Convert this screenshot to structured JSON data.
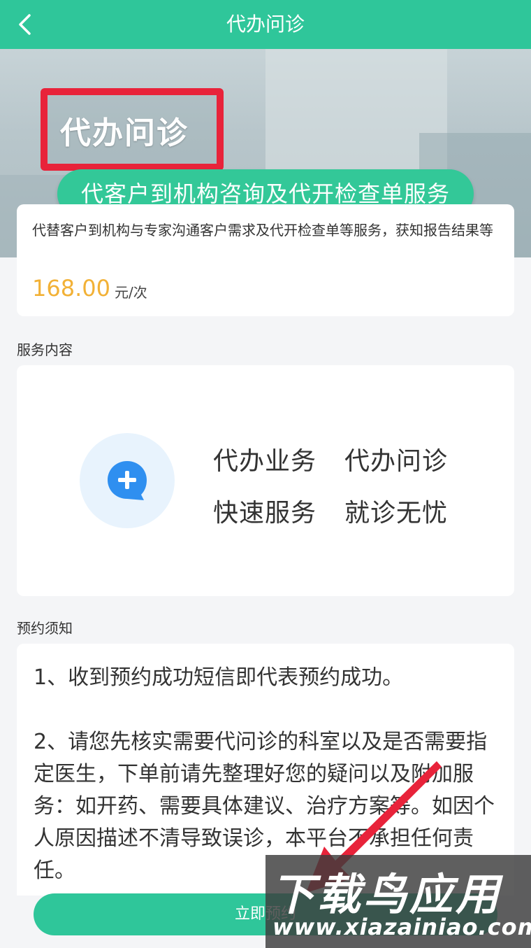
{
  "header": {
    "title": "代办问诊"
  },
  "banner": {
    "title": "代办问诊",
    "subtitle": "代客户到机构咨询及代开检查单服务"
  },
  "price_card": {
    "description": "代替客户到机构与专家沟通客户需求及代开检查单等服务，获知报告结果等",
    "price": "168.00",
    "unit": "元/次"
  },
  "service": {
    "section_label": "服务内容",
    "tags": [
      "代办业务",
      "代办问诊",
      "快速服务",
      "就诊无忧"
    ]
  },
  "notice": {
    "section_label": "预约须知",
    "items": [
      "1、收到预约成功短信即代表预约成功。",
      "2、请您先核实需要代问诊的科室以及是否需要指定医生，下单前请先整理好您的疑问以及附加服务：如开药、需要具体建议、治疗方案等。如因个人原因描述不清导致误诊，本平台不承担任何责任。"
    ]
  },
  "bottom_button": {
    "label": "立即预约"
  },
  "watermark": {
    "logo": "下载鸟应用",
    "url": "www.xiazainiao.com"
  },
  "colors": {
    "primary": "#2fc69a",
    "price": "#f2b136",
    "highlight": "#e8233a"
  }
}
